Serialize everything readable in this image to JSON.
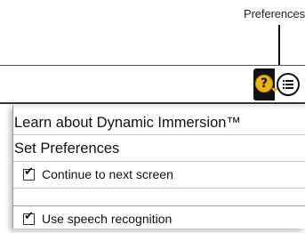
{
  "callout": {
    "label": "Preferences"
  },
  "toolbar": {
    "help_icon_glyph": "?",
    "help_icon": "help-question-icon",
    "preferences_icon": "list-menu-icon",
    "accent_color": "#f0b400"
  },
  "menu": {
    "items": [
      {
        "label": "Learn about Dynamic Immersion™"
      },
      {
        "label": "Set Preferences"
      },
      {
        "label": "Continue to next screen",
        "checked": true,
        "check_glyph": "✔"
      },
      {
        "label": "Use speech recognition",
        "checked": true,
        "check_glyph": "✔"
      }
    ]
  }
}
